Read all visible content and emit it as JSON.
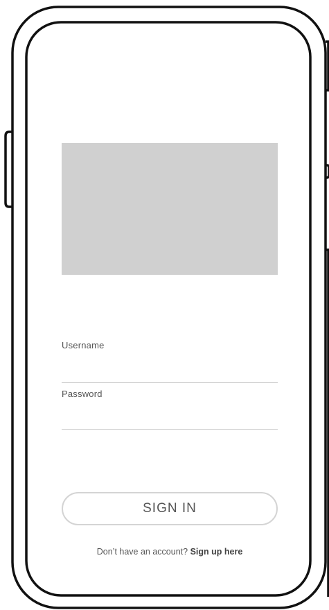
{
  "form": {
    "username_label": "Username",
    "username_value": "",
    "password_label": "Password",
    "password_value": ""
  },
  "actions": {
    "signin_label": "SIGN IN",
    "signup_prompt": "Don’t have an account? ",
    "signup_link": "Sign up here"
  },
  "colors": {
    "image_placeholder": "#d0d0d0",
    "frame_stroke": "#111111",
    "input_underline": "#c8c8c8",
    "button_border": "#d4d4d4"
  }
}
